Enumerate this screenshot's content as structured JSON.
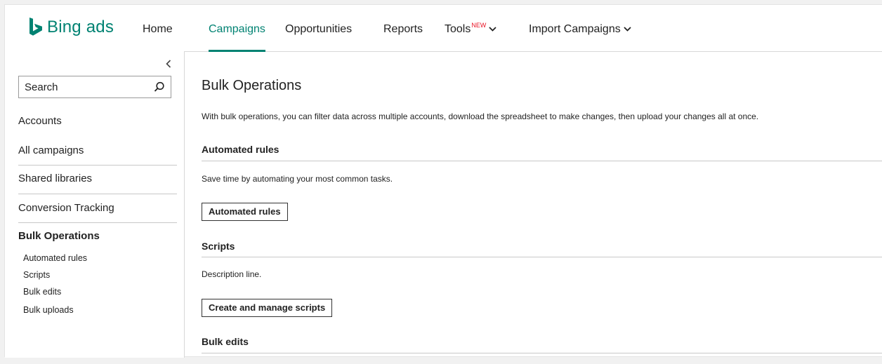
{
  "brand": {
    "name": "Bing",
    "suffix": "ads",
    "color": "#008272"
  },
  "nav": {
    "items": [
      {
        "label": "Home"
      },
      {
        "label": "Campaigns",
        "active": true
      },
      {
        "label": "Opportunities"
      },
      {
        "label": "Reports"
      },
      {
        "label": "Tools",
        "badge": "NEW"
      },
      {
        "label": "Import Campaigns"
      }
    ]
  },
  "sidebar": {
    "search_placeholder": "Search",
    "links": [
      "Accounts",
      "All campaigns",
      "Shared libraries",
      "Conversion Tracking"
    ],
    "section_heading": "Bulk Operations",
    "sub_items": [
      "Automated rules",
      "Scripts",
      "Bulk edits",
      "Bulk uploads"
    ]
  },
  "main": {
    "title": "Bulk Operations",
    "description": "With bulk operations, you can filter data across multiple accounts, download the spreadsheet to make changes, then upload your changes all at once.",
    "sections": [
      {
        "title": "Automated rules",
        "description": "Save time by automating your most common tasks.",
        "button": "Automated rules"
      },
      {
        "title": "Scripts",
        "description": "Description line.",
        "button": "Create and manage scripts"
      },
      {
        "title": "Bulk edits"
      }
    ]
  },
  "colors": {
    "accent": "#008272",
    "badge": "#e81123",
    "separator": "#c8c8c8"
  },
  "icons": [
    "bing-logo-icon",
    "chevron-down-icon",
    "search-icon",
    "collapse-chevron-left-icon"
  ]
}
